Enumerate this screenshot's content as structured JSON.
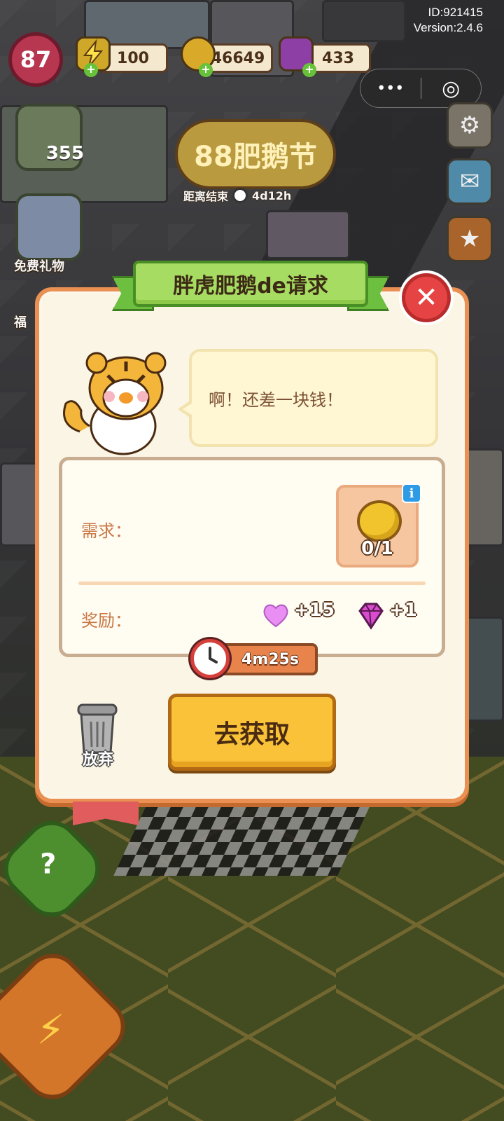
{
  "hud": {
    "level": "87",
    "energy": "100",
    "coins": "46649",
    "gems": "433",
    "id_text": "ID:921415",
    "version_text": "Version:2.4.6"
  },
  "mini_program": {
    "more_glyph": "•••",
    "close_glyph": "◎"
  },
  "left_widgets": {
    "puzzle_count": "355",
    "free_gift_label": "免费礼物",
    "welfare_label": "福"
  },
  "event": {
    "logo_text": "88肥鹅节",
    "timer_prefix": "距离结束",
    "timer_value": "4d12h"
  },
  "dialog": {
    "title": "胖虎肥鹅de请求",
    "speech": "啊！还差一块钱！",
    "requirement_label": "需求：",
    "reward_label": "奖励：",
    "coin_progress": "0/1",
    "info_glyph": "i",
    "heart_reward": "+15",
    "gem_reward": "+1",
    "timer": "4m25s",
    "abandon_label": "放弃",
    "go_button": "去获取",
    "close_glyph": "✕"
  },
  "colors": {
    "dialog_border": "#e99052",
    "title_ribbon": "#a6dc62",
    "go_button": "#f9c238",
    "close_button": "#e64444",
    "label_text": "#c97846"
  },
  "icons": [
    "energy-icon",
    "coin-icon",
    "gem-icon",
    "gear-icon",
    "mail-icon",
    "star-icon",
    "trash-icon",
    "clock-icon",
    "heart-icon",
    "info-icon",
    "help-icon",
    "lightning-icon"
  ]
}
